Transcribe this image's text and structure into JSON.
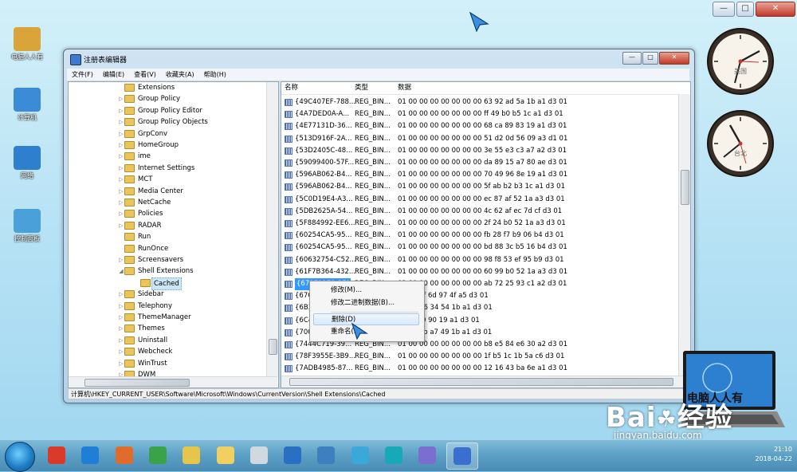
{
  "desktop": {
    "icons": [
      {
        "label": "电脑人人有",
        "color": "#d9a53a"
      },
      {
        "label": "计算机",
        "color": "#3b8bd6"
      },
      {
        "label": "网络",
        "color": "#2f7fcf"
      },
      {
        "label": "控制面板",
        "color": "#4aa0d8"
      }
    ],
    "clocks": [
      {
        "label": "美国"
      },
      {
        "label": "台北"
      }
    ],
    "watermark": "Bai",
    "watermark2": "经验",
    "watermark_url": "jingyan.baidu.com",
    "laptop_text": "电脑人人有"
  },
  "window": {
    "title": "注册表编辑器",
    "menu": [
      "文件(F)",
      "编辑(E)",
      "查看(V)",
      "收藏夹(A)",
      "帮助(H)"
    ],
    "tree": [
      {
        "label": "Extensions",
        "arrow": ""
      },
      {
        "label": "Group Policy",
        "arrow": "▷"
      },
      {
        "label": "Group Policy Editor",
        "arrow": "▷"
      },
      {
        "label": "Group Policy Objects",
        "arrow": "▷"
      },
      {
        "label": "GrpConv",
        "arrow": "▷"
      },
      {
        "label": "HomeGroup",
        "arrow": "▷"
      },
      {
        "label": "ime",
        "arrow": "▷"
      },
      {
        "label": "Internet Settings",
        "arrow": "▷"
      },
      {
        "label": "MCT",
        "arrow": "▷"
      },
      {
        "label": "Media Center",
        "arrow": "▷"
      },
      {
        "label": "NetCache",
        "arrow": "▷"
      },
      {
        "label": "Policies",
        "arrow": "▷"
      },
      {
        "label": "RADAR",
        "arrow": "▷"
      },
      {
        "label": "Run",
        "arrow": ""
      },
      {
        "label": "RunOnce",
        "arrow": ""
      },
      {
        "label": "Screensavers",
        "arrow": "▷"
      },
      {
        "label": "Shell Extensions",
        "arrow": "◢"
      },
      {
        "label": "Cached",
        "arrow": "",
        "child": true,
        "selected": true
      },
      {
        "label": "Sidebar",
        "arrow": "▷"
      },
      {
        "label": "Telephony",
        "arrow": "▷"
      },
      {
        "label": "ThemeManager",
        "arrow": "▷"
      },
      {
        "label": "Themes",
        "arrow": "▷"
      },
      {
        "label": "Uninstall",
        "arrow": "▷"
      },
      {
        "label": "Webcheck",
        "arrow": "▷"
      },
      {
        "label": "WinTrust",
        "arrow": "▷"
      },
      {
        "label": "DWM",
        "arrow": "▷"
      }
    ],
    "columns": {
      "name": "名称",
      "type": "类型",
      "data": "数据"
    },
    "rows": [
      {
        "name": "{49C407EF-788...",
        "type": "REG_BIN...",
        "data": "01 00 00 00 00 00 00 00 63 92 ad 5a 1b a1 d3 01"
      },
      {
        "name": "{4A7DED0A-A...",
        "type": "REG_BIN...",
        "data": "01 00 00 00 00 00 00 00 ff 49 b0 b5 1c a1 d3 01"
      },
      {
        "name": "{4E77131D-36...",
        "type": "REG_BIN...",
        "data": "01 00 00 00 00 00 00 00 68 ca 89 83 19 a1 d3 01"
      },
      {
        "name": "{513D916F-2A...",
        "type": "REG_BIN...",
        "data": "01 00 00 00 00 00 00 00 51 d2 0d 56 09 a3 d1 01"
      },
      {
        "name": "{53D2405C-48...",
        "type": "REG_BIN...",
        "data": "01 00 00 00 00 00 00 00 3e 55 e3 c3 a7 a2 d3 01"
      },
      {
        "name": "{59099400-57F...",
        "type": "REG_BIN...",
        "data": "01 00 00 00 00 00 00 00 da 89 15 a7 80 ae d3 01"
      },
      {
        "name": "{596AB062-B4...",
        "type": "REG_BIN...",
        "data": "01 00 00 00 00 00 00 00 70 49 96 8e 19 a1 d3 01"
      },
      {
        "name": "{596AB062-B4...",
        "type": "REG_BIN...",
        "data": "01 00 00 00 00 00 00 00 5f ab b2 b3 1c a1 d3 01"
      },
      {
        "name": "{5C0D19E4-A3...",
        "type": "REG_BIN...",
        "data": "01 00 00 00 00 00 00 00 ec 87 af 52 1a a3 d3 01"
      },
      {
        "name": "{5DB2625A-54...",
        "type": "REG_BIN...",
        "data": "01 00 00 00 00 00 00 00 4c 62 af ec 7d cf d3 01"
      },
      {
        "name": "{5F884992-EE6...",
        "type": "REG_BIN...",
        "data": "01 00 00 00 00 00 00 00 2f 24 b0 52 1a a3 d3 01"
      },
      {
        "name": "{60254CA5-95...",
        "type": "REG_BIN...",
        "data": "01 00 00 00 00 00 00 00 fb 28 f7 b9 06 b4 d3 01"
      },
      {
        "name": "{60254CA5-95...",
        "type": "REG_BIN...",
        "data": "01 00 00 00 00 00 00 00 bd 88 3c b5 16 b4 d3 01"
      },
      {
        "name": "{60632754-C52...",
        "type": "REG_BIN...",
        "data": "01 00 00 00 00 00 00 00 98 f8 53 ef 95 b9 d3 01"
      },
      {
        "name": "{61F7B364-432...",
        "type": "REG_BIN...",
        "data": "01 00 00 00 00 00 00 00 60 99 b0 52 1a a3 d3 01"
      },
      {
        "name": "{679E1279-2E(",
        "type": "REG_BIN...",
        "data": "01 00 00 00 00 00 00 00 ab 72 25 93 c1 a2 d3 01",
        "selected": true
      },
      {
        "name": "{67C",
        "type": "",
        "data": "00 e8 3f 6d 97 4f a5 d3 01"
      },
      {
        "name": "{6B3",
        "type": "",
        "data": "00 83 86 34 54 1b a1 d3 01"
      },
      {
        "name": "{6C4(",
        "type": "",
        "data": "00 f6 80 90 19 a1 d3 01"
      },
      {
        "name": "{700",
        "type": "",
        "data": "00 2a 0b a7 49 1b a1 d3 01"
      },
      {
        "name": "{7444C719-39...",
        "type": "REG_BIN...",
        "data": "01 00 00 00 00 00 00 00 b8 e5 84 e6 30 a2 d3 01"
      },
      {
        "name": "{78F3955E-3B9...",
        "type": "REG_BIN...",
        "data": "01 00 00 00 00 00 00 00 1f b5 1c 1b 5a c6 d3 01"
      },
      {
        "name": "{7ADB4985-87...",
        "type": "REG_BIN...",
        "data": "01 00 00 00 00 00 00 00 12 16 43 ba 6e a1 d3 01"
      }
    ],
    "status": "计算机\\HKEY_CURRENT_USER\\Software\\Microsoft\\Windows\\CurrentVersion\\Shell Extensions\\Cached"
  },
  "context_menu": {
    "items": [
      "修改(M)...",
      "修改二进制数据(B)...",
      "删除(D)",
      "重命名(R)"
    ],
    "highlighted": 2
  },
  "taskbar": {
    "apps": [
      {
        "color": "#d93a2a"
      },
      {
        "color": "#1f7fd6"
      },
      {
        "color": "#e06b2a"
      },
      {
        "color": "#3aa34a"
      },
      {
        "color": "#e6c54a"
      },
      {
        "color": "#f0d060"
      },
      {
        "color": "#d0d8e0"
      },
      {
        "color": "#2a6fc2"
      },
      {
        "color": "#3d7fbf"
      },
      {
        "color": "#3aa8d8"
      },
      {
        "color": "#17a9b8"
      },
      {
        "color": "#7a6fd0"
      },
      {
        "color": "#3a6fcf"
      }
    ],
    "time": "21:10",
    "date": "2018-04-22"
  }
}
